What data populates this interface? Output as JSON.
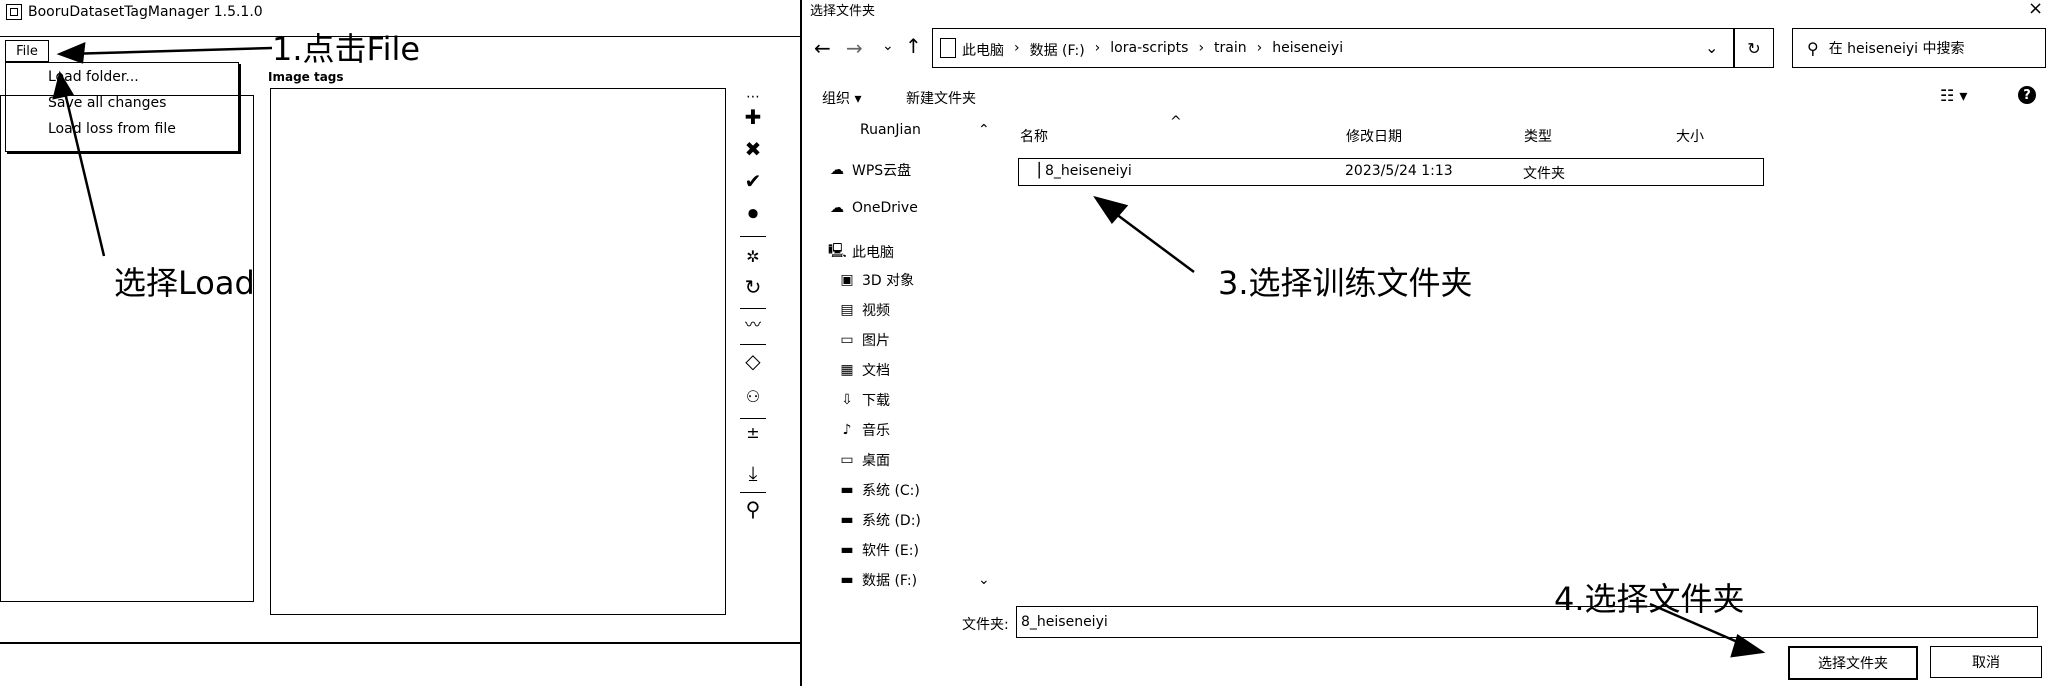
{
  "left_app": {
    "title": "BooruDatasetTagManager 1.5.1.0",
    "menu": {
      "file_label": "File"
    },
    "dropdown": {
      "items": [
        "Load folder...",
        "Save all changes",
        "Load loss from file"
      ]
    },
    "image_tags_label": "Image tags",
    "tools": [
      "plus-icon",
      "shuffle-icon",
      "check-icon",
      "record-icon",
      "sep",
      "sparkle-icon",
      "refresh-icon",
      "sep",
      "wave-icon",
      "sep",
      "tag-icon",
      "person-search-icon",
      "sep",
      "plus-minus-icon",
      "sep",
      "download-icon",
      "sep",
      "search-icon"
    ]
  },
  "dialog": {
    "title": "选择文件夹",
    "close": "×",
    "nav": {
      "back": "←",
      "forward": "→",
      "recent": "⌄",
      "up": "↑"
    },
    "breadcrumb": [
      "此电脑",
      "›",
      "数据 (F:)",
      "›",
      "lora-scripts",
      "›",
      "train",
      "›",
      "heiseneiyi"
    ],
    "address_dropdown": "⌄",
    "refresh": "↻",
    "search_placeholder": "在 heiseneiyi 中搜索",
    "toolbar": {
      "organize": "组织 ▾",
      "new_folder": "新建文件夹",
      "view": "☷ ▾",
      "help": "?"
    },
    "nav_pane": [
      {
        "label": "RuanJian",
        "icon": ""
      },
      {
        "label": "WPS云盘",
        "icon": "☁"
      },
      {
        "label": "OneDrive",
        "icon": "☁"
      },
      {
        "label": "此电脑",
        "icon": "🖳"
      },
      {
        "label": "3D 对象",
        "icon": "▣"
      },
      {
        "label": "视频",
        "icon": "▤"
      },
      {
        "label": "图片",
        "icon": "▭"
      },
      {
        "label": "文档",
        "icon": "▦"
      },
      {
        "label": "下载",
        "icon": "⇩"
      },
      {
        "label": "音乐",
        "icon": "♪"
      },
      {
        "label": "桌面",
        "icon": "▭"
      },
      {
        "label": "系统 (C:)",
        "icon": "▬"
      },
      {
        "label": "系统 (D:)",
        "icon": "▬"
      },
      {
        "label": "软件 (E:)",
        "icon": "▬"
      },
      {
        "label": "数据 (F:)",
        "icon": "▬"
      }
    ],
    "scroll": {
      "up": "⌃",
      "down": "⌄"
    },
    "columns": {
      "name": "名称",
      "modified": "修改日期",
      "type": "类型",
      "size": "大小"
    },
    "sort_caret": "^",
    "files": [
      {
        "name": "8_heiseneiyi",
        "modified": "2023/5/24 1:13",
        "type": "文件夹",
        "size": ""
      }
    ],
    "folder_label": "文件夹:",
    "folder_value": "8_heiseneiyi",
    "select_button": "选择文件夹",
    "cancel_button": "取消"
  },
  "annotations": {
    "step1": "1.点击File",
    "step2": "选择Load",
    "step3": "3.选择训练文件夹",
    "step4": "4.选择文件夹"
  },
  "colors": {
    "ink": "#000000",
    "background": "#ffffff"
  }
}
